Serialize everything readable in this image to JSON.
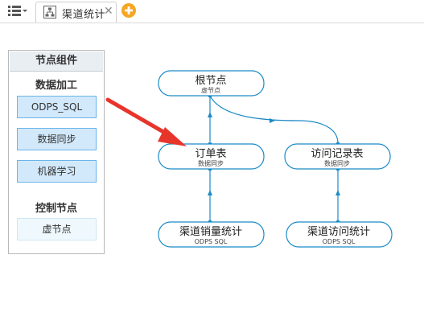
{
  "tabbar": {
    "menu_icon": "list-menu-icon",
    "tab": {
      "icon": "flow-diagram-icon",
      "label": "渠道统计",
      "close": "✕"
    },
    "add_icon": "add-circle-icon"
  },
  "panel": {
    "title": "节点组件",
    "sections": [
      {
        "title": "数据加工",
        "items": [
          "ODPS_SQL",
          "数据同步",
          "机器学习"
        ]
      },
      {
        "title": "控制节点",
        "items": [
          "虚节点"
        ]
      }
    ]
  },
  "flow": {
    "nodes": [
      {
        "id": "root",
        "name": "根节点",
        "type": "虚节点"
      },
      {
        "id": "order",
        "name": "订单表",
        "type": "数据同步"
      },
      {
        "id": "visit",
        "name": "访问记录表",
        "type": "数据同步"
      },
      {
        "id": "sales",
        "name": "渠道销量统计",
        "type": "ODPS SQL"
      },
      {
        "id": "access",
        "name": "渠道访问统计",
        "type": "ODPS SQL"
      }
    ],
    "edges": [
      {
        "from": "root",
        "to": "order"
      },
      {
        "from": "root",
        "to": "visit"
      },
      {
        "from": "order",
        "to": "sales"
      },
      {
        "from": "visit",
        "to": "access"
      }
    ]
  },
  "colors": {
    "node_border": "#1b8ac6",
    "edge": "#1b8ac6",
    "arrow": "#e8352b",
    "component_fill": "#d2e9fb",
    "component_border": "#6ab4e8",
    "add_button": "#f5a623"
  }
}
